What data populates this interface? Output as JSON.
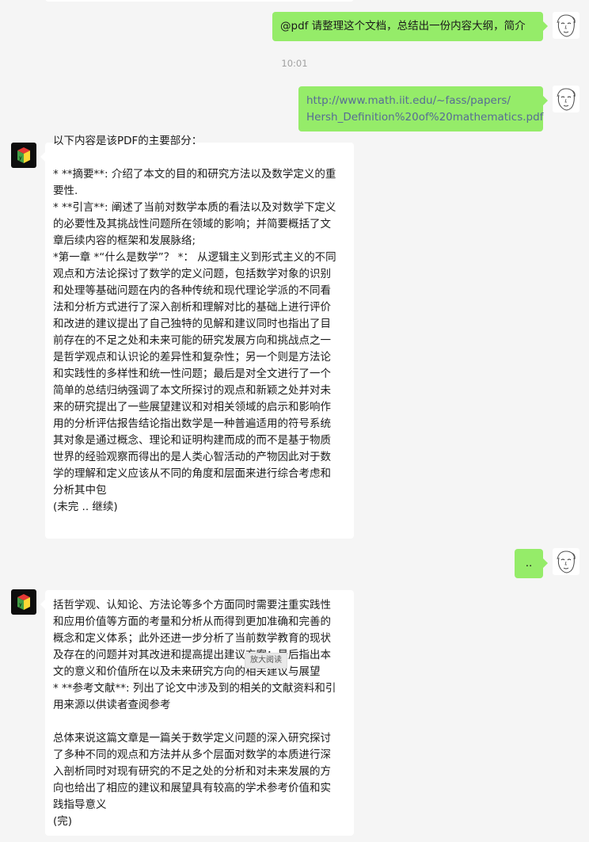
{
  "chat": {
    "messages": [
      {
        "id": "m1",
        "sender": "user",
        "text": "@pdf 请整理这个文档，总结出一份内容大纲，简介"
      },
      {
        "id": "ts1",
        "type": "timestamp",
        "text": "10:01"
      },
      {
        "id": "m2",
        "sender": "user",
        "type": "link",
        "lines": [
          "http://www.math.iit.edu/~fass/papers/",
          "Hersh_Definition%20of%20mathematics.pdf"
        ]
      },
      {
        "id": "m3",
        "sender": "bot",
        "lines": [
          "以下内容是该PDF的主要部分：",
          "",
          "* **摘要**: 介绍了本文的目的和研究方法以及数学定义的重",
          "要性.",
          "* **引言**: 阐述了当前对数学本质的看法以及对数学下定义",
          "的必要性及其挑战性问题所在领域的影响；并简要概括了文",
          "章后续内容的框架和发展脉络;",
          "*第一章 *“什么是数学”？ *： 从逻辑主义到形式主义的不同",
          "观点和方法论探讨了数学的定义问题，包括数学对象的识别",
          "和处理等基础问题在内的各种传统和现代理论学派的不同看",
          "法和分析方式进行了深入剖析和理解对比的基础上进行评价",
          "和改进的建议提出了自己独特的见解和建议同时也指出了目",
          "前存在的不足之处和未来可能的研究发展方向和挑战点之一",
          "是哲学观点和认识论的差异性和复杂性；另一个则是方法论",
          "和实践性的多样性和统一性问题；最后是对全文进行了一个",
          "简单的总结归纳强调了本文所探讨的观点和新颖之处并对未",
          "来的研究提出了一些展望建议和对相关领域的启示和影响作",
          "用的分析评估报告结论指出数学是一种普遍适用的符号系统",
          "其对象是通过概念、理论和证明构建而成的而不是基于物质",
          "世界的经验观察而得出的是人类心智活动的产物因此对于数",
          "学的理解和定义应该从不同的角度和层面来进行综合考虑和",
          "分析其中包",
          "(未完 .. 继续)"
        ]
      },
      {
        "id": "m4",
        "sender": "user",
        "text": ".."
      },
      {
        "id": "m5",
        "sender": "bot",
        "lines": [
          "括哲学观、认知论、方法论等多个方面同时需要注重实践性",
          "和应用价值等方面的考量和分析从而得到更加准确和完善的",
          "概念和定义体系；此外还进一步分析了当前数学教育的现状",
          "及存在的问题并对其改进和提高提出建议方案；最后指出本",
          "文的意义和价值所在以及未来研究方向的相关建议与展望",
          "* **参考文献**: 列出了论文中涉及到的相关的文献资料和引",
          "用来源以供读者查阅参考",
          "",
          "总体来说这篇文章是一篇关于数学定义问题的深入研究探讨",
          "了多种不同的观点和方法并从多个层面对数学的本质进行深",
          "入剖析同时对现有研究的不足之处的分析和对未来发展的方",
          "向也给出了相应的建议和展望具有较高的学术参考价值和实",
          "践指导意义",
          "(完)"
        ]
      }
    ],
    "hover_tip": "放大阅读"
  },
  "colors": {
    "background": "#f5f5f5",
    "outgoing_bubble": "#95ec69",
    "incoming_bubble": "#ffffff",
    "link": "#576b95",
    "timestamp": "#a0a0a0"
  },
  "icons": {
    "user_avatar": "sketch-face-avatar-icon",
    "bot_avatar": "color-cube-avatar-icon"
  }
}
